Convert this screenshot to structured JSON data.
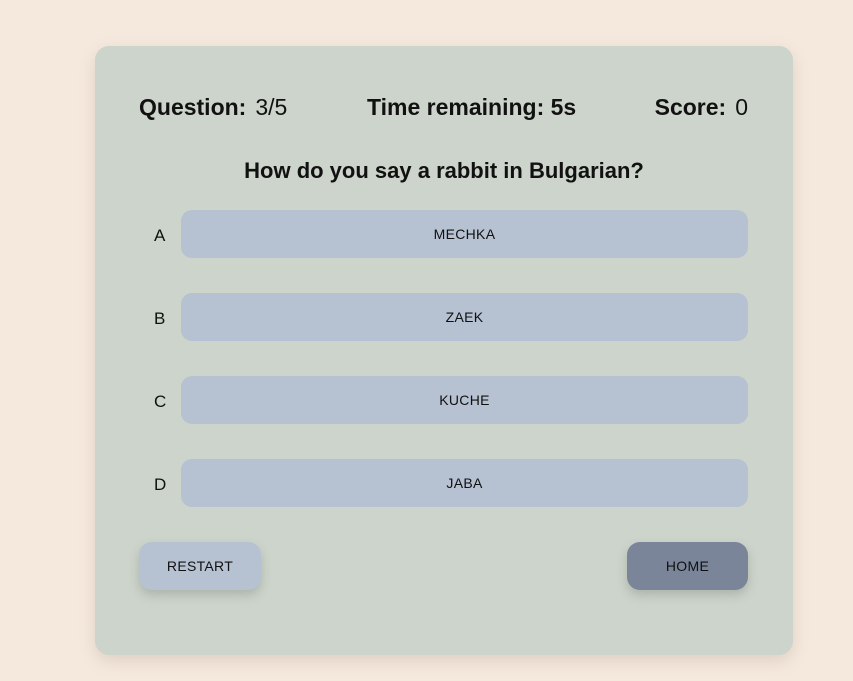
{
  "stats": {
    "question_label": "Question:",
    "question_value": "3/5",
    "time_label": "Time remaining: 5s",
    "score_label": "Score:",
    "score_value": "0"
  },
  "question": {
    "text": "How do you say a rabbit in Bulgarian?"
  },
  "answers": [
    {
      "letter": "A",
      "text": "MECHKA"
    },
    {
      "letter": "B",
      "text": "ZAEK"
    },
    {
      "letter": "C",
      "text": "KUCHE"
    },
    {
      "letter": "D",
      "text": "JABA"
    }
  ],
  "actions": {
    "restart_label": "RESTART",
    "home_label": "HOME"
  },
  "colors": {
    "page_background": "#f5e9de",
    "card_background": "#cdd4cb",
    "answer_button": "#b6c1d2",
    "home_button": "#7a8599"
  }
}
